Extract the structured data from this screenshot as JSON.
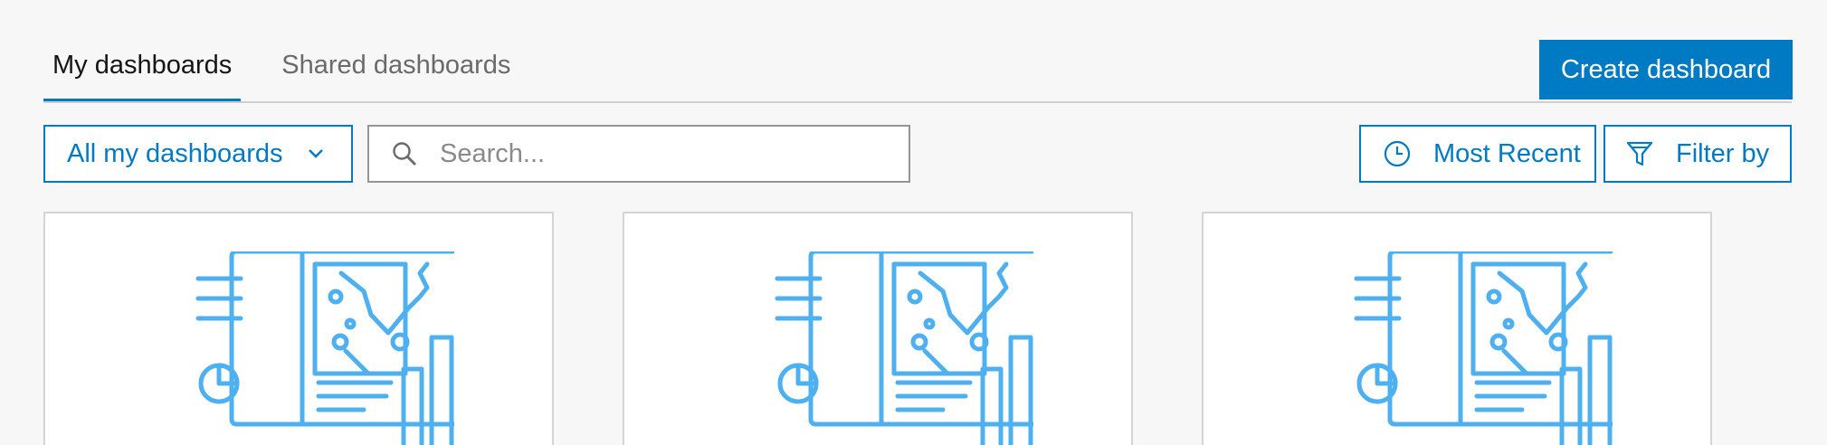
{
  "tabs": [
    {
      "label": "My dashboards",
      "active": true
    },
    {
      "label": "Shared dashboards",
      "active": false
    }
  ],
  "toolbar": {
    "create_label": "Create dashboard",
    "scope_label": "All my dashboards",
    "search_placeholder": "Search...",
    "sort_label": "Most Recent",
    "filter_label": "Filter by"
  },
  "icons": {
    "scope": "chevron-down-icon",
    "search": "search-icon",
    "sort": "clock-icon",
    "filter": "funnel-icon",
    "card": "dashboard-thumbnail-icon"
  },
  "colors": {
    "accent": "#007ac2",
    "thumbnail": "#4fb0ef",
    "background": "#f7f7f7",
    "active_text": "#151515",
    "inactive_text": "#6a6a6a"
  },
  "cards": [
    {
      "icon": "dashboard-thumbnail-icon"
    },
    {
      "icon": "dashboard-thumbnail-icon"
    },
    {
      "icon": "dashboard-thumbnail-icon"
    }
  ]
}
